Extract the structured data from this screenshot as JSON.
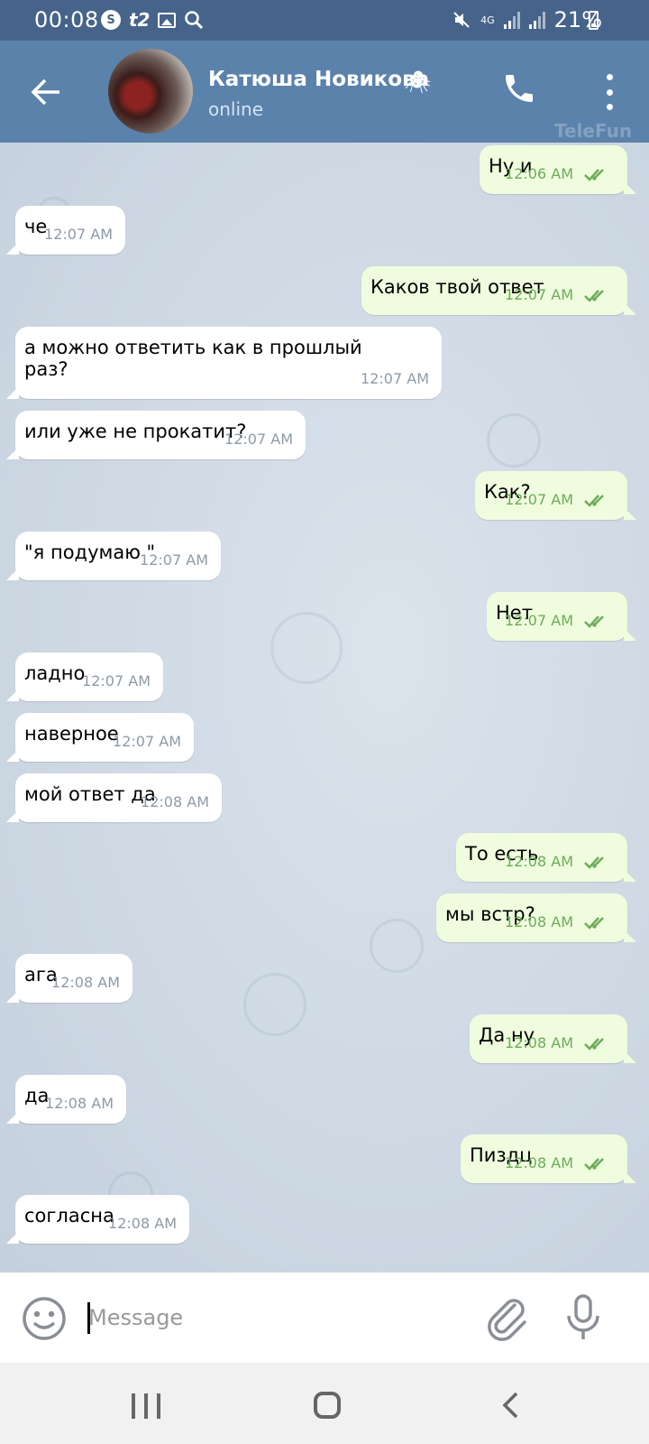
{
  "status_bar": {
    "time": "00:08",
    "left_icons": [
      "shazam-icon",
      "t2-icon",
      "image-icon",
      "search-icon"
    ],
    "t2_label": "t2",
    "network_label": "4G",
    "battery": "21%"
  },
  "header": {
    "contact_name": "Катюша Новикова",
    "contact_emoji": "🕷",
    "status": "online",
    "watermark": "TeleFun"
  },
  "messages": [
    {
      "direction": "out",
      "text": "Ну и",
      "time": "12:06 AM",
      "read": true
    },
    {
      "direction": "in",
      "text": "че",
      "time": "12:07 AM"
    },
    {
      "direction": "out",
      "text": "Каков твой ответ",
      "time": "12:07 AM",
      "read": true
    },
    {
      "direction": "in",
      "text": "а можно ответить как в прошлый раз?",
      "time": "12:07 AM"
    },
    {
      "direction": "in",
      "text": "или уже не прокатит?",
      "time": "12:07 AM"
    },
    {
      "direction": "out",
      "text": "Как?",
      "time": "12:07 AM",
      "read": true
    },
    {
      "direction": "in",
      "text": "\"я подумаю \"",
      "time": "12:07 AM"
    },
    {
      "direction": "out",
      "text": "Нет",
      "time": "12:07 AM",
      "read": true
    },
    {
      "direction": "in",
      "text": "ладно",
      "time": "12:07 AM"
    },
    {
      "direction": "in",
      "text": "наверное",
      "time": "12:07 AM"
    },
    {
      "direction": "in",
      "text": "мой ответ да",
      "time": "12:08 AM"
    },
    {
      "direction": "out",
      "text": "То есть",
      "time": "12:08 AM",
      "read": true
    },
    {
      "direction": "out",
      "text": "мы встр?",
      "time": "12:08 AM",
      "read": true
    },
    {
      "direction": "in",
      "text": "ага",
      "time": "12:08 AM"
    },
    {
      "direction": "out",
      "text": "Да ну",
      "time": "12:08 AM",
      "read": true
    },
    {
      "direction": "in",
      "text": "да",
      "time": "12:08 AM"
    },
    {
      "direction": "out",
      "text": "Пиздц",
      "time": "12:08 AM",
      "read": true
    },
    {
      "direction": "in",
      "text": "согласна",
      "time": "12:08 AM"
    }
  ],
  "input": {
    "placeholder": "Message",
    "value": ""
  },
  "colors": {
    "status_bar": "#46648a",
    "header": "#5b82ab",
    "incoming_bubble": "#ffffff",
    "outgoing_bubble": "#effdde",
    "read_check": "#6dab5a"
  }
}
